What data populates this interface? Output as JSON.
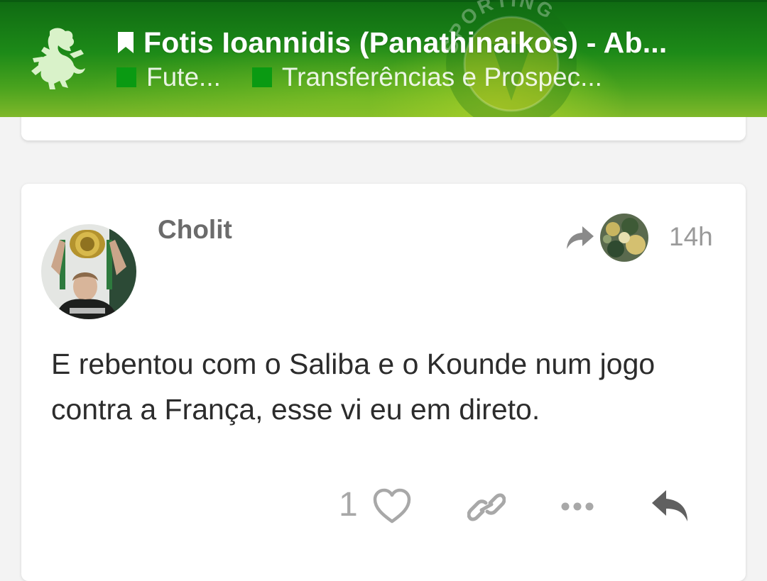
{
  "header": {
    "topic_title": "Fotis Ioannidis (Panathinaikos) - Ab...",
    "categories": [
      {
        "name": "Fute...",
        "color": "#0a9a12"
      },
      {
        "name": "Transferências e Prospec...",
        "color": "#0a9a12"
      }
    ],
    "logo_icon": "lion-crest-icon",
    "bookmark_icon": "bookmark-icon",
    "watermark_letters": "SPORTING PORTUGAL"
  },
  "post": {
    "username": "Cholit",
    "time": "14h",
    "reply_to_icon": "share-arrow-icon",
    "body_lines": [
      "E rebentou com o Saliba e o Kounde num jogo",
      "contra a França, esse vi eu em direto."
    ],
    "like_count": "1",
    "actions": [
      "heart-icon",
      "link-icon",
      "more-icon",
      "reply-icon"
    ]
  },
  "colors": {
    "header_green": "#1d8a18",
    "category_green": "#0a9a12",
    "text_main": "#2c2c2c",
    "text_muted": "#9a9a9a",
    "card_bg": "#ffffff",
    "page_bg": "#f3f3f3"
  }
}
